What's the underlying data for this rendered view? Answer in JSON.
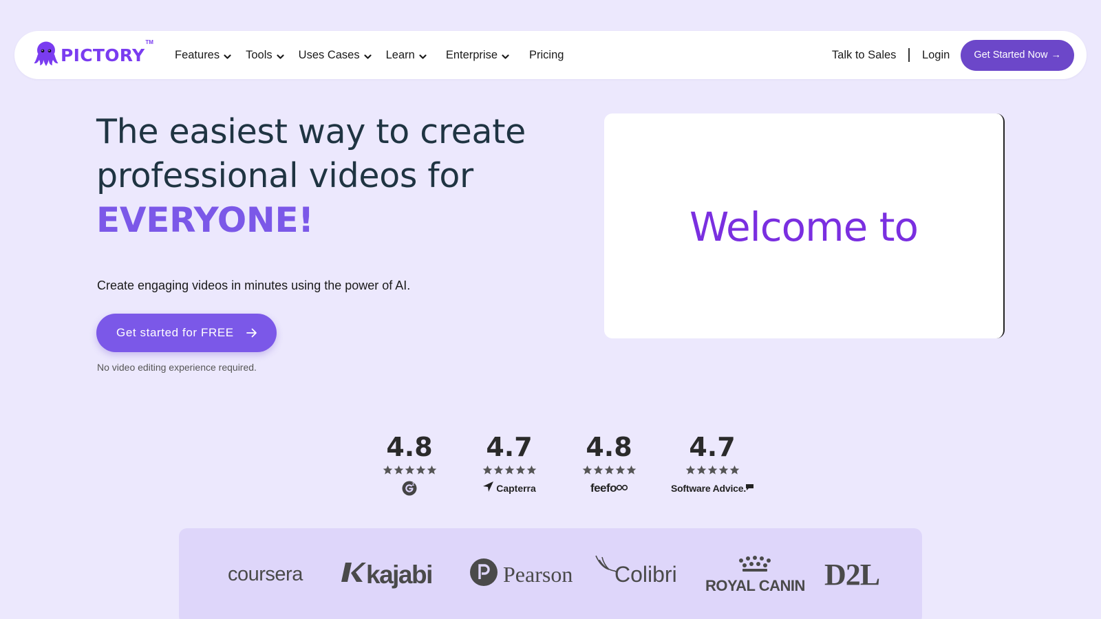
{
  "nav": {
    "logo_text": "PICTORY",
    "logo_tm": "TM",
    "items": [
      {
        "label": "Features",
        "has_dropdown": true
      },
      {
        "label": "Tools",
        "has_dropdown": true
      },
      {
        "label": "Uses Cases",
        "has_dropdown": true
      },
      {
        "label": "Learn",
        "has_dropdown": true
      },
      {
        "label": "Enterprise",
        "has_dropdown": true
      },
      {
        "label": "Pricing",
        "has_dropdown": false
      }
    ],
    "talk_to_sales": "Talk to Sales",
    "login": "Login",
    "cta_label": "Get Started Now",
    "cta_arrow": "→"
  },
  "hero": {
    "title_line1": "The easiest way to create",
    "title_line2": "professional videos for",
    "title_accent": "EVERYONE!",
    "subtitle": "Create engaging videos in minutes using the power of AI.",
    "cta_label": "Get started for FREE",
    "cta_note": "No video editing experience required."
  },
  "video": {
    "caption": "Welcome to"
  },
  "ratings": [
    {
      "value": "4.8",
      "stars": 5,
      "source": "G2"
    },
    {
      "value": "4.7",
      "stars": 5,
      "source": "Capterra"
    },
    {
      "value": "4.8",
      "stars": 5,
      "source": "feefo"
    },
    {
      "value": "4.7",
      "stars": 5,
      "source": "Software Advice."
    }
  ],
  "customers": {
    "coursera": "coursera",
    "kajabi": "kajabi",
    "pearson": "Pearson",
    "colibri": "Colibri",
    "royal_canin": "ROYAL CANIN",
    "d2l": "D2L"
  },
  "colors": {
    "background": "#ECE8FD",
    "brand_purple": "#7A3CF0",
    "cta_purple": "#7B58E8",
    "nav_cta": "#6C47C9",
    "heading": "#1F3442",
    "logo_band": "#DED6FA"
  }
}
